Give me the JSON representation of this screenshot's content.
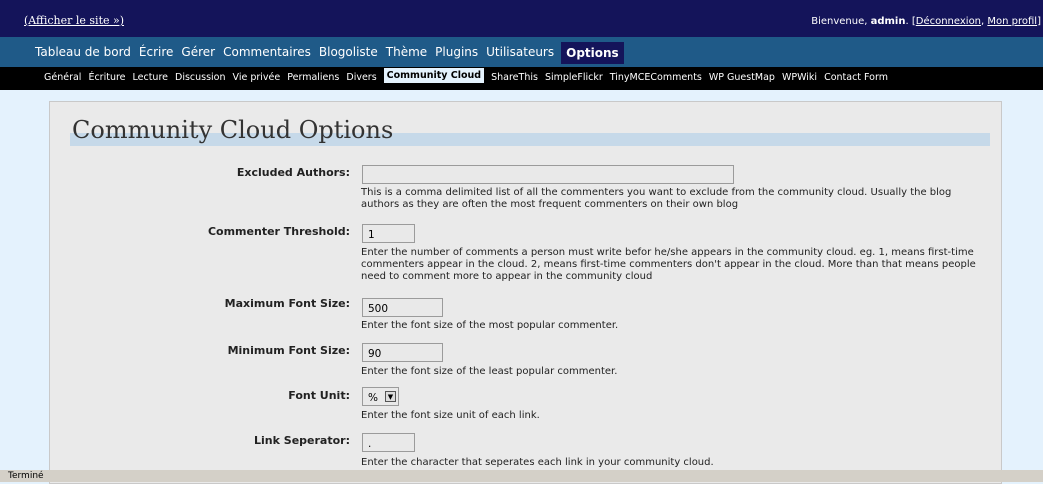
{
  "topbar": {
    "view_site": "(Afficher le site »)",
    "welcome_prefix": "Bienvenue, ",
    "username": "admin",
    "logout": "Déconnexion",
    "sep": ", ",
    "profile": "Mon profil"
  },
  "mainnav": {
    "items": [
      {
        "label": "Tableau de bord"
      },
      {
        "label": "Écrire"
      },
      {
        "label": "Gérer"
      },
      {
        "label": "Commentaires"
      },
      {
        "label": "Blogoliste"
      },
      {
        "label": "Thème"
      },
      {
        "label": "Plugins"
      },
      {
        "label": "Utilisateurs"
      },
      {
        "label": "Options"
      }
    ],
    "active": "Options"
  },
  "subnav": {
    "items": [
      {
        "label": "Général"
      },
      {
        "label": "Écriture"
      },
      {
        "label": "Lecture"
      },
      {
        "label": "Discussion"
      },
      {
        "label": "Vie privée"
      },
      {
        "label": "Permaliens"
      },
      {
        "label": "Divers"
      },
      {
        "label": "Community Cloud"
      },
      {
        "label": "ShareThis"
      },
      {
        "label": "SimpleFlickr"
      },
      {
        "label": "TinyMCEComments"
      },
      {
        "label": "WP GuestMap"
      },
      {
        "label": "WPWiki"
      },
      {
        "label": "Contact Form"
      }
    ],
    "active": "Community Cloud"
  },
  "main": {
    "title": "Community Cloud Options",
    "fields": {
      "excluded_authors": {
        "label": "Excluded Authors:",
        "value": "",
        "help": "This is a comma delimited list of all the commenters you want to exclude from the community cloud. Usually the blog authors as they are often the most frequent commenters on their own blog"
      },
      "commenter_threshold": {
        "label": "Commenter Threshold:",
        "value": "1",
        "help": "Enter the number of comments a person must write befor he/she appears in the community cloud. eg. 1, means first-time commenters appear in the cloud. 2, means first-time commenters don't appear in the cloud. More than that means people need to comment more to appear in the community cloud"
      },
      "max_font_size": {
        "label": "Maximum Font Size:",
        "value": "500",
        "help": "Enter the font size of the most popular commenter."
      },
      "min_font_size": {
        "label": "Minimum Font Size:",
        "value": "90",
        "help": "Enter the font size of the least popular commenter."
      },
      "font_unit": {
        "label": "Font Unit:",
        "value": "%",
        "help": "Enter the font size unit of each link."
      },
      "link_separator": {
        "label": "Link Seperator:",
        "value": ".",
        "help": "Enter the character that seperates each link in your community cloud."
      }
    }
  },
  "statusbar": {
    "text": "Terminé"
  },
  "colors": {
    "topbar_bg": "#14145a",
    "mainnav_bg": "#1f5a88",
    "subnav_bg": "#000000",
    "page_bg": "#e4f2fd",
    "title_underline": "#c6d9e9"
  }
}
